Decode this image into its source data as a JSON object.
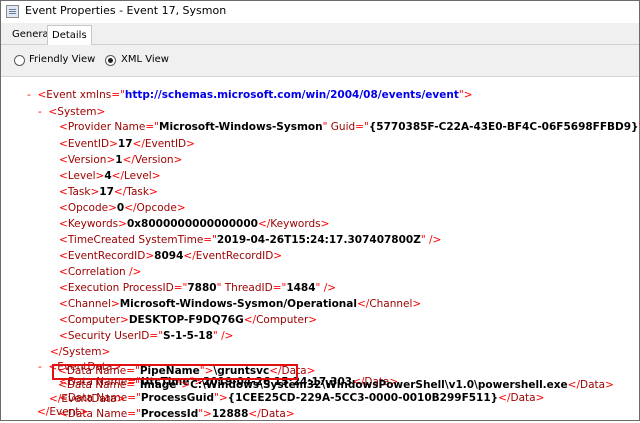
{
  "window": {
    "title": "Event Properties - Event 17, Sysmon"
  },
  "tabs": [
    {
      "label": "General"
    },
    {
      "label": "Details"
    }
  ],
  "view_options": {
    "friendly_label": "Friendly View",
    "xml_label": "XML View",
    "selected": "XML View"
  },
  "xml_lines": {
    "event_open": {
      "collapse": "-",
      "tag": "Event",
      "attr": "xmlns",
      "value": "http://schemas.microsoft.com/win/2004/08/events/event"
    },
    "system_open": {
      "collapse": "-",
      "tag": "System"
    },
    "provider": {
      "tag": "Provider",
      "attr1": "Name",
      "val1": "Microsoft-Windows-Sysmon",
      "attr2": "Guid",
      "val2": "{5770385F-C22A-43E0-BF4C-06F5698FFBD9}"
    },
    "eventid": {
      "tag": "EventID",
      "value": "17"
    },
    "version": {
      "tag": "Version",
      "value": "1"
    },
    "level": {
      "tag": "Level",
      "value": "4"
    },
    "task": {
      "tag": "Task",
      "value": "17"
    },
    "opcode": {
      "tag": "Opcode",
      "value": "0"
    },
    "keywords": {
      "tag": "Keywords",
      "value": "0x8000000000000000"
    },
    "timecreated": {
      "tag": "TimeCreated",
      "attr": "SystemTime",
      "value": "2019-04-26T15:24:17.307407800Z"
    },
    "recordid": {
      "tag": "EventRecordID",
      "value": "8094"
    },
    "correlation": {
      "tag": "Correlation"
    },
    "execution": {
      "tag": "Execution",
      "attr1": "ProcessID",
      "val1": "7880",
      "attr2": "ThreadID",
      "val2": "1484"
    },
    "channel": {
      "tag": "Channel",
      "value": "Microsoft-Windows-Sysmon/Operational"
    },
    "computer": {
      "tag": "Computer",
      "value": "DESKTOP-F9DQ76G"
    },
    "security": {
      "tag": "Security",
      "attr": "UserID",
      "value": "S-1-5-18"
    },
    "system_close": {
      "tag": "System"
    },
    "eventdata_open": {
      "collapse": "-",
      "tag": "EventData"
    },
    "data_utctime": {
      "tag": "Data",
      "attr": "Name",
      "name": "UtcTime",
      "value": "2019-04-26 15:24:17.303"
    },
    "data_processguid": {
      "tag": "Data",
      "attr": "Name",
      "name": "ProcessGuid",
      "value": "{1CEE25CD-229A-5CC3-0000-0010B299F511}"
    },
    "data_processid": {
      "tag": "Data",
      "attr": "Name",
      "name": "ProcessId",
      "value": "12888"
    },
    "data_pipename": {
      "tag": "Data",
      "attr": "Name",
      "name": "PipeName",
      "value": "\\gruntsvc"
    },
    "data_image": {
      "tag": "Data",
      "attr": "Name",
      "name": "Image",
      "value": "C:\\Windows\\System32\\WindowsPowerShell\\v1.0\\powershell.exe"
    },
    "eventdata_close": {
      "tag": "EventData"
    },
    "event_close": {
      "tag": "Event"
    }
  },
  "colors": {
    "highlight_border": "#e11111",
    "xml_markup": "#ff0000",
    "xml_tag": "#990000",
    "xml_namespace": "#0000ee"
  }
}
